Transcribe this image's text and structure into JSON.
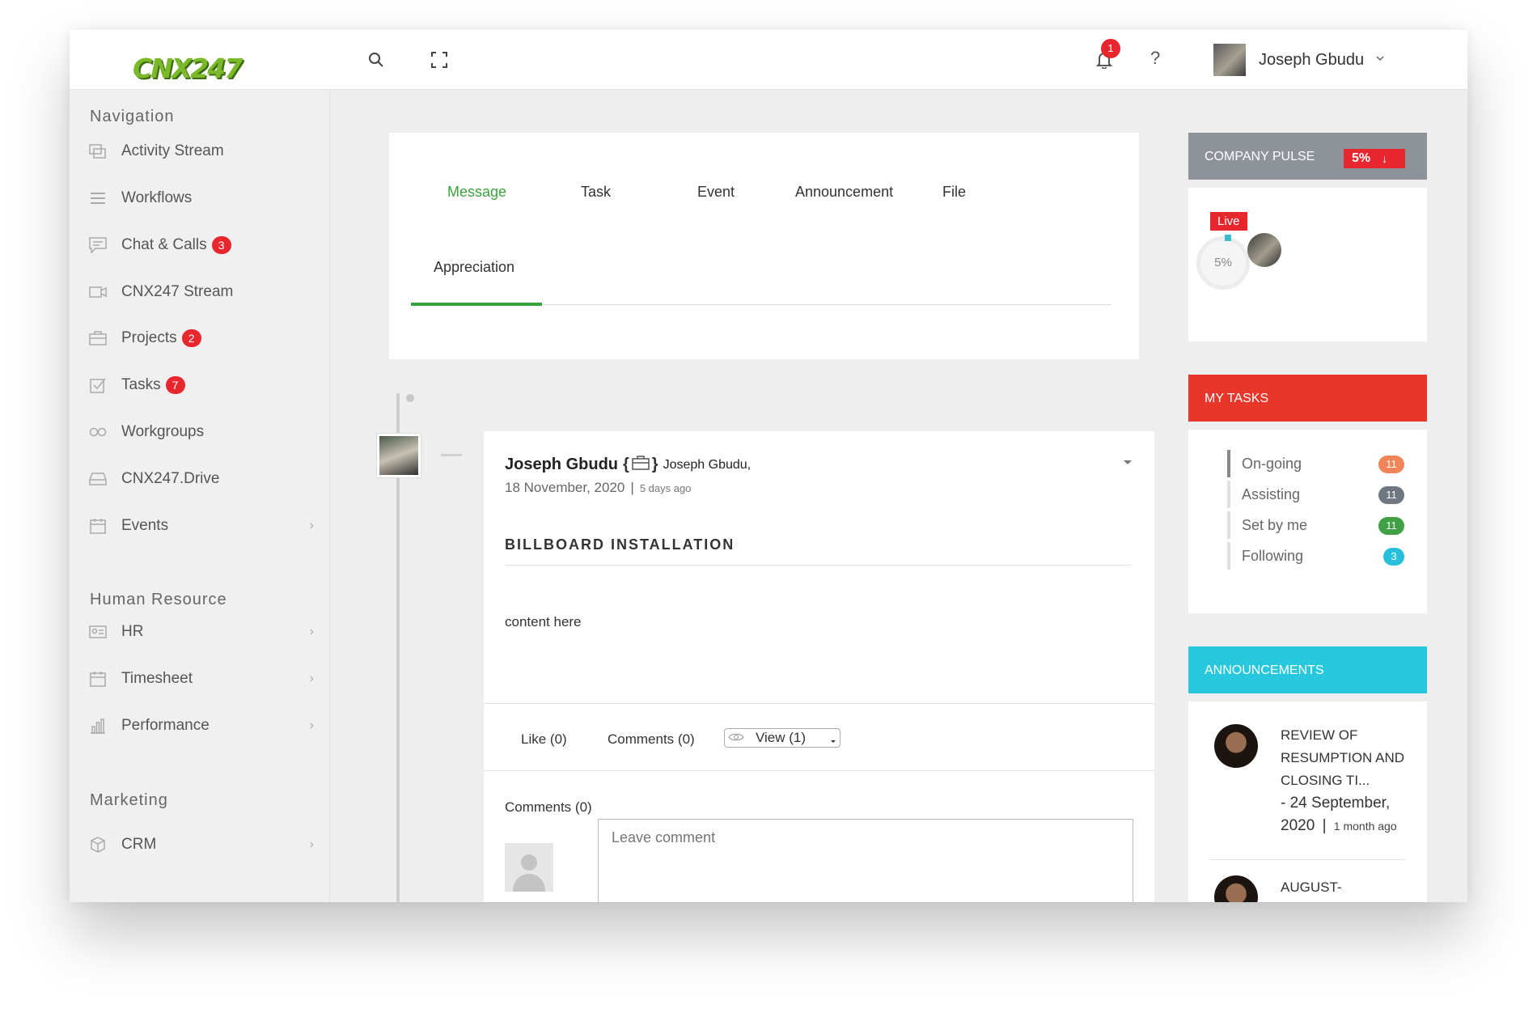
{
  "topbar": {
    "logo_text": "CNX247",
    "notification_count": "1",
    "help_label": "?",
    "user_name": "Joseph Gbudu"
  },
  "sidebar": {
    "sections": [
      {
        "title": "Navigation"
      },
      {
        "title": "Human Resource"
      },
      {
        "title": "Marketing"
      }
    ],
    "items": [
      {
        "label": "Activity Stream",
        "icon": "activity-stream-icon"
      },
      {
        "label": "Workflows",
        "icon": "menu-icon"
      },
      {
        "label": "Chat & Calls",
        "icon": "chat-icon",
        "badge": "3"
      },
      {
        "label": "CNX247 Stream",
        "icon": "video-camera-icon"
      },
      {
        "label": "Projects",
        "icon": "briefcase-icon",
        "badge": "2"
      },
      {
        "label": "Tasks",
        "icon": "checkbox-icon",
        "badge": "7"
      },
      {
        "label": "Workgroups",
        "icon": "infinity-icon"
      },
      {
        "label": "CNX247.Drive",
        "icon": "drive-icon"
      },
      {
        "label": "Events",
        "icon": "calendar-icon"
      },
      {
        "label": "HR",
        "icon": "id-card-icon"
      },
      {
        "label": "Timesheet",
        "icon": "calendar-icon"
      },
      {
        "label": "Performance",
        "icon": "bar-chart-icon"
      },
      {
        "label": "CRM",
        "icon": "cube-icon"
      }
    ]
  },
  "composer": {
    "tabs": [
      "Message",
      "Task",
      "Event",
      "Announcement",
      "File",
      "Appreciation"
    ]
  },
  "post": {
    "author": "Joseph Gbudu",
    "brace_open": "{",
    "brace_close": "}",
    "recipient": "Joseph Gbudu,",
    "date": "18 November, 2020",
    "separator": "|",
    "relative_time": "5 days ago",
    "title": "BILLBOARD INSTALLATION",
    "content": "content here",
    "like_label": "Like (0)",
    "comments_label": "Comments (0)",
    "view_label": "View (1)",
    "comments_heading": "Comments (0)",
    "comment_placeholder": "Leave comment"
  },
  "company_pulse": {
    "title": "COMPANY PULSE",
    "percent": "5%",
    "arrow": "↓",
    "live_label": "Live",
    "gauge_value": "5%"
  },
  "my_tasks": {
    "title": "MY TASKS",
    "items": [
      {
        "label": "On-going",
        "count": "11",
        "color": "#f0855a"
      },
      {
        "label": "Assisting",
        "count": "11",
        "color": "#6f7780"
      },
      {
        "label": "Set by me",
        "count": "11",
        "color": "#3fa143"
      },
      {
        "label": "Following",
        "count": "3",
        "color": "#27c0dc"
      }
    ]
  },
  "announcements": {
    "title": "ANNOUNCEMENTS",
    "items": [
      {
        "line1": "REVIEW OF",
        "line2": "RESUMPTION AND",
        "line3": "CLOSING TI...",
        "date1": "- 24 September,",
        "date2": "2020",
        "sep": "|",
        "ago": "1 month ago"
      },
      {
        "line1": "AUGUST-"
      }
    ]
  },
  "colors": {
    "accent_green": "#3aa33c",
    "pulse_header": "#8d9399",
    "tasks_header": "#e8362b",
    "announcements_header": "#27c8de",
    "badge_red": "#e8262d"
  }
}
